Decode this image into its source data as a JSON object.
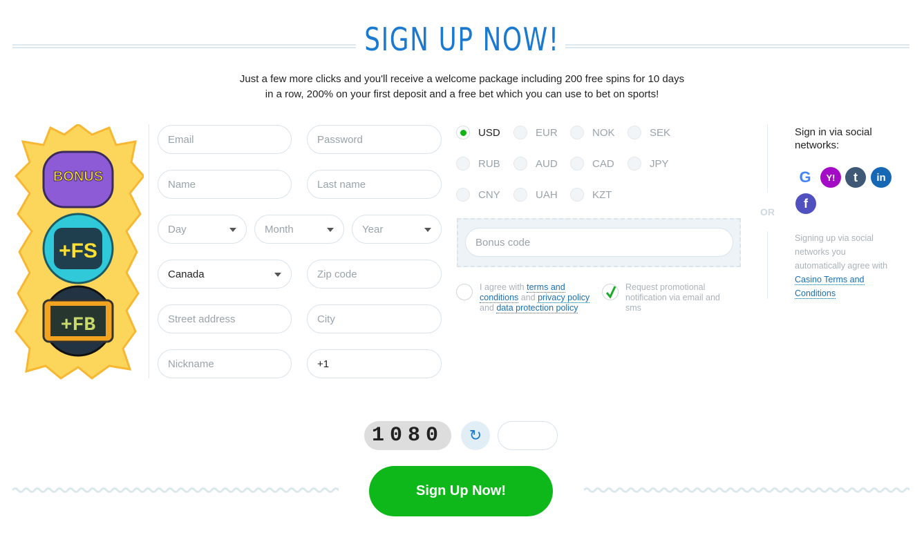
{
  "header": {
    "title": "SIGN UP NOW!",
    "subtitle": "Just a few more clicks and you'll receive a welcome package including 200 free spins for 10 days in a row, 200% on your first deposit and a free bet which you can use to bet on sports!"
  },
  "promo_art": {
    "labels": [
      "BONUS",
      "+FS",
      "+FB"
    ]
  },
  "form": {
    "email": "Email",
    "password": "Password",
    "name": "Name",
    "last_name": "Last name",
    "day": "Day",
    "month": "Month",
    "year": "Year",
    "country": "Canada",
    "zip": "Zip code",
    "street": "Street address",
    "city": "City",
    "nickname": "Nickname",
    "phone": "+1"
  },
  "currencies": {
    "selected": "USD",
    "items": [
      "USD",
      "EUR",
      "NOK",
      "SEK",
      "RUB",
      "AUD",
      "CAD",
      "JPY",
      "CNY",
      "UAH",
      "KZT"
    ]
  },
  "bonus": {
    "placeholder": "Bonus code"
  },
  "agree": {
    "t1": "I agree with ",
    "l1": "terms and conditions",
    "t2": " and ",
    "l2": "privacy policy",
    "t3": " and ",
    "l3": "data protection policy",
    "checked": false
  },
  "promo_notify": {
    "text": "Request promotional notification via email and sms",
    "checked": true
  },
  "or": "OR",
  "social": {
    "title": "Sign in via social networks:",
    "networks": [
      "google",
      "yahoo",
      "tumblr",
      "linkedin",
      "facebook"
    ],
    "note": "Signing up via social networks you automatically agree with",
    "link": "Casino Terms and Conditions"
  },
  "captcha": {
    "code": "1080",
    "input": ""
  },
  "submit": "Sign Up Now!",
  "colors": {
    "accent": "#1a7ad0",
    "button": "#0fb81a",
    "link": "#1a6fb5"
  }
}
